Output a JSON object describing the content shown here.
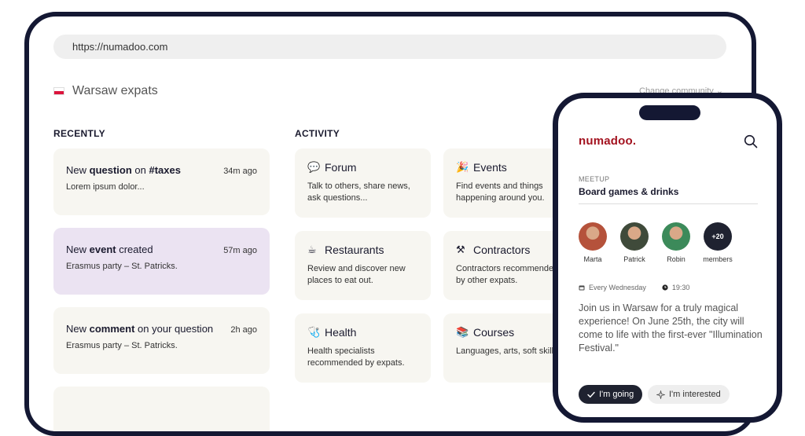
{
  "browser": {
    "url": "https://numadoo.com"
  },
  "community": {
    "name": "Warsaw expats",
    "change_label": "Change community ⌄"
  },
  "recently": {
    "title": "RECENTLY",
    "items": [
      {
        "prefix": "New ",
        "bold": "question",
        "suffix": " on ",
        "bold2": "#taxes",
        "time": "34m ago",
        "sub": "Lorem ipsum dolor..."
      },
      {
        "prefix": "New ",
        "bold": "event",
        "suffix": " created",
        "bold2": "",
        "time": "57m ago",
        "sub": "Erasmus party – St. Patricks."
      },
      {
        "prefix": "New ",
        "bold": "comment",
        "suffix": " on your question",
        "bold2": "",
        "time": "2h ago",
        "sub": "Erasmus party – St. Patricks."
      }
    ]
  },
  "activity": {
    "title": "ACTIVITY",
    "cards": [
      {
        "emoji": "💬",
        "title": "Forum",
        "desc": "Talk to others, share news, ask questions..."
      },
      {
        "emoji": "🎉",
        "title": "Events",
        "desc": "Find events and things happening around you."
      },
      {
        "emoji": "☕",
        "title": "Restaurants",
        "desc": "Review and discover new places to eat out."
      },
      {
        "emoji": "⚒",
        "title": "Contractors",
        "desc": "Contractors recommended by other expats."
      },
      {
        "emoji": "🩺",
        "title": "Health",
        "desc": "Health specialists recommended by expats."
      },
      {
        "emoji": "📚",
        "title": "Courses",
        "desc": "Languages, arts, soft skills..."
      }
    ]
  },
  "phone": {
    "brand": "numadoo.",
    "meetup_label": "MEETUP",
    "meetup_title": "Board games & drinks",
    "attendees": [
      {
        "name": "Marta",
        "color": "#b5523b"
      },
      {
        "name": "Patrick",
        "color": "#3f4a3a"
      },
      {
        "name": "Robin",
        "color": "#3c8a5a"
      }
    ],
    "more_count": "+20",
    "more_label": "members",
    "schedule": "Every Wednesday",
    "time": "19:30",
    "description": "Join us in Warsaw for a truly magical experience! On June 25th, the city will come to life with the first-ever \"Illumination Festival.\"",
    "going_label": "I'm going",
    "interested_label": "I'm interested"
  }
}
